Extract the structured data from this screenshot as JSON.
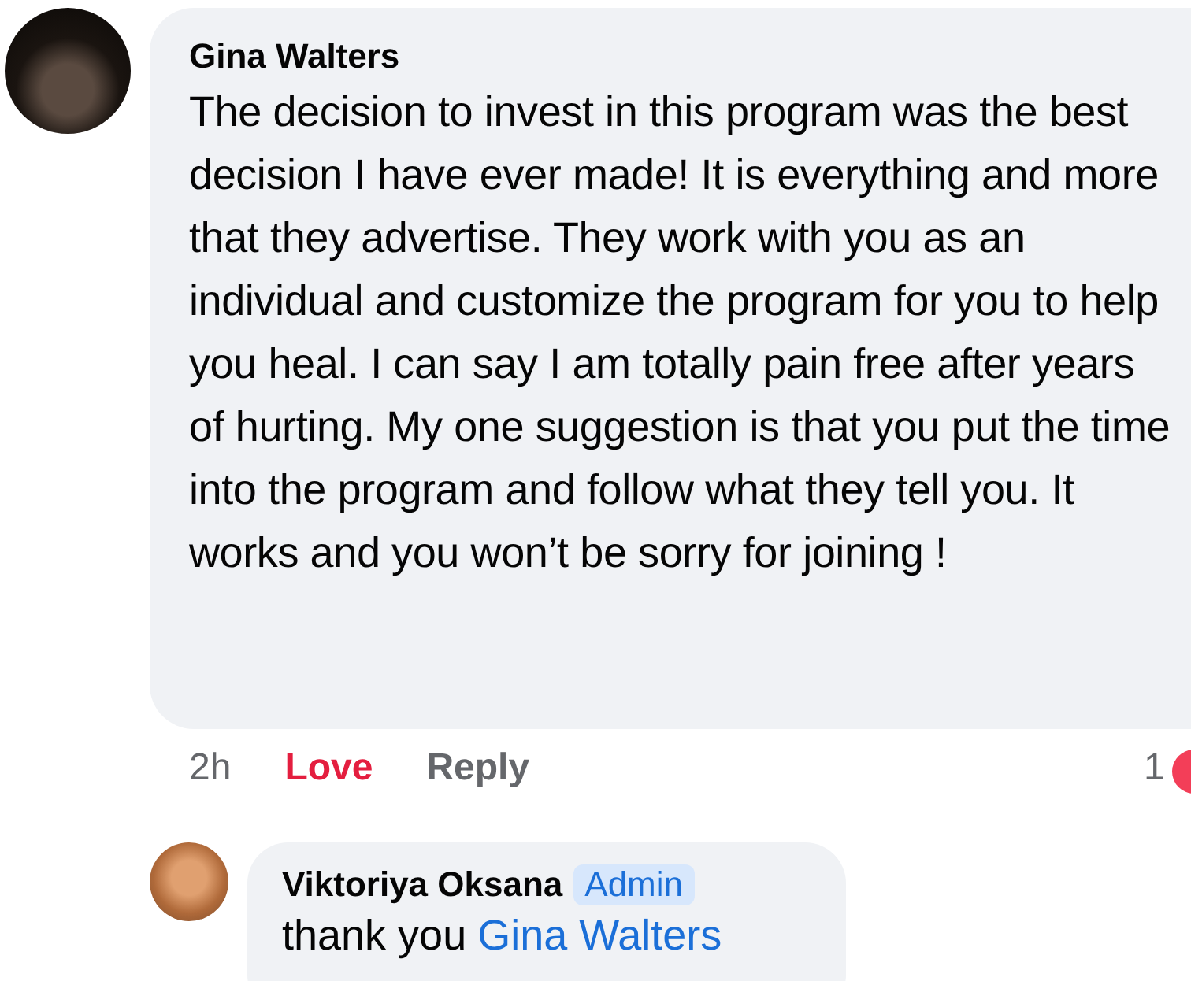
{
  "comment": {
    "author": "Gina Walters",
    "text": "The decision to invest in this program was the best decision I have ever made! It is everything and more that they advertise. They work with you as an individual and customize the program for you to help you heal. I can say I am totally pain free after years of hurting. My one suggestion is that you put the time into the program and follow what they tell you. It works and you won’t be sorry for joining !",
    "actions": [
      {
        "kind": "time",
        "label": "2h"
      },
      {
        "kind": "reaction",
        "label": "Love"
      },
      {
        "kind": "reply",
        "label": "Reply"
      }
    ],
    "reaction_count": "1"
  },
  "reply": {
    "author": "Viktoriya Oksana",
    "badge": "Admin",
    "text": "thank you",
    "mention": "Gina Walters"
  }
}
